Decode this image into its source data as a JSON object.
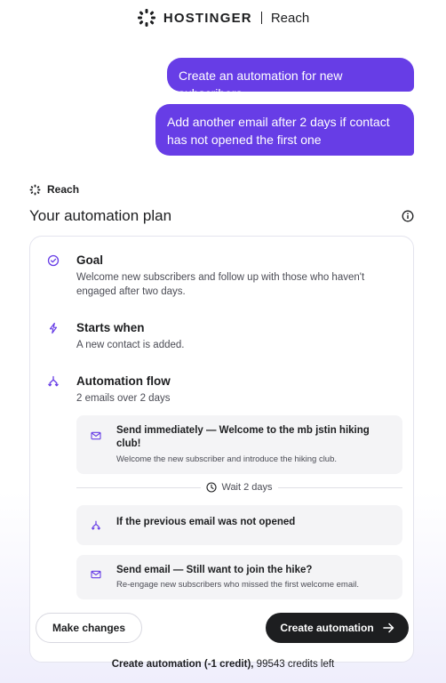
{
  "header": {
    "brand": "HOSTINGER",
    "product": "Reach",
    "logo_icon": "hostinger-logo-icon"
  },
  "chat": {
    "messages": [
      "Create an automation for new subscribers",
      "Add another email after 2 days if contact has not opened the first one"
    ],
    "agent_name": "Reach"
  },
  "plan": {
    "title": "Your automation plan",
    "goal": {
      "title": "Goal",
      "text": "Welcome new subscribers and follow up with those who haven't engaged after two days."
    },
    "trigger": {
      "title": "Starts when",
      "text": "A new contact is added."
    },
    "flow": {
      "title": "Automation flow",
      "text": "2 emails over 2 days",
      "steps": [
        {
          "title": "Send immediately — Welcome to the mb jstin hiking club!",
          "subtitle": "Welcome the new subscriber and introduce the hiking club."
        },
        {
          "title": "If the previous email was not opened"
        },
        {
          "title": "Send email — Still want to join the hike?",
          "subtitle": "Re-engage new subscribers who missed the first welcome email."
        }
      ],
      "wait_label": "Wait 2 days"
    },
    "buttons": {
      "make_changes": "Make changes",
      "create": "Create automation"
    }
  },
  "footer": {
    "cost": "Create automation (-1 credit),",
    "credits": "99543 credits left"
  },
  "colors": {
    "accent": "#673de6",
    "dark": "#1d1e20"
  }
}
